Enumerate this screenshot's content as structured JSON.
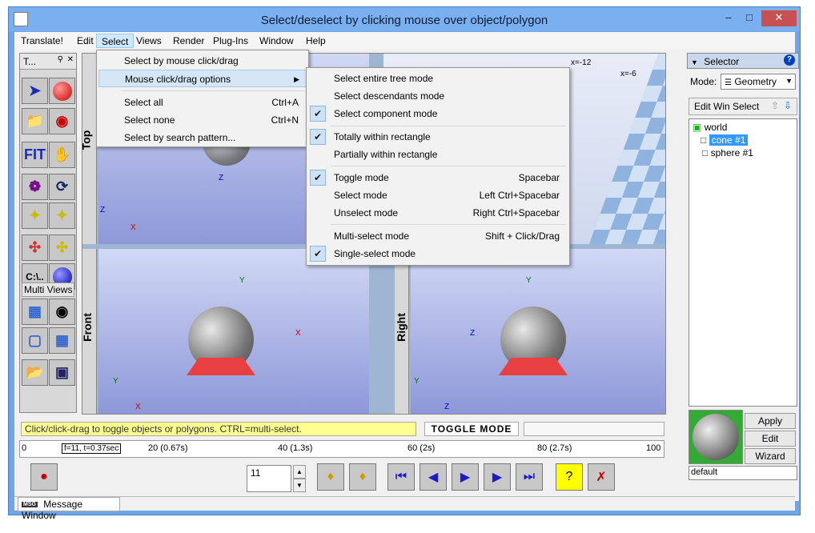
{
  "window": {
    "title": "Select/deselect by clicking mouse over object/polygon"
  },
  "menubar": [
    "Translate!",
    "Edit",
    "Select",
    "Views",
    "Render",
    "Plug-Ins",
    "Window",
    "Help"
  ],
  "select_menu": {
    "items": [
      {
        "label": "Select by mouse click/drag",
        "shortcut": ""
      },
      {
        "label": "Mouse click/drag options",
        "shortcut": ""
      },
      {
        "label": "Select all",
        "shortcut": "Ctrl+A"
      },
      {
        "label": "Select none",
        "shortcut": "Ctrl+N"
      },
      {
        "label": "Select by search pattern...",
        "shortcut": ""
      }
    ]
  },
  "options_submenu": {
    "items": [
      {
        "label": "Select entire tree mode",
        "shortcut": "",
        "checked": false
      },
      {
        "label": "Select descendants mode",
        "shortcut": "",
        "checked": false
      },
      {
        "label": "Select component mode",
        "shortcut": "",
        "checked": true
      },
      {
        "label": "Totally within rectangle",
        "shortcut": "",
        "checked": true
      },
      {
        "label": "Partially within rectangle",
        "shortcut": "",
        "checked": false
      },
      {
        "label": "Toggle mode",
        "shortcut": "Spacebar",
        "checked": true
      },
      {
        "label": "Select mode",
        "shortcut": "Left Ctrl+Spacebar",
        "checked": false
      },
      {
        "label": "Unselect mode",
        "shortcut": "Right Ctrl+Spacebar",
        "checked": false
      },
      {
        "label": "Multi-select mode",
        "shortcut": "Shift + Click/Drag",
        "checked": false
      },
      {
        "label": "Single-select mode",
        "shortcut": "",
        "checked": true
      }
    ]
  },
  "toolbox": {
    "title": "T...",
    "multi_views_label": "Multi Views",
    "fit_label": "FIT",
    "path_label": "C:\\.."
  },
  "viewports": {
    "top": "Top",
    "front": "Front",
    "right": "Right",
    "axis_z": "Z",
    "axis_y": "Y",
    "axis_x": "X",
    "coord_x1": "x=-12",
    "coord_x2": "x=-6"
  },
  "selector": {
    "title": "Selector",
    "mode_label": "Mode:",
    "mode_value": "Geometry",
    "tools": "Edit  Win  Select",
    "tree": [
      "world",
      "cone #1",
      "sphere #1"
    ],
    "buttons": [
      "Apply",
      "Edit",
      "Wizard"
    ],
    "material_name": "default"
  },
  "status": {
    "message": "Click/click-drag to toggle objects or polygons. CTRL=multi-select.",
    "mode": "TOGGLE MODE"
  },
  "timeline": {
    "frame_readout": "f=11, t=0.37sec",
    "ticks": [
      "0",
      "20 (0.67s)",
      "40 (1.3s)",
      "60 (2s)",
      "80 (2.7s)",
      "100"
    ]
  },
  "controls": {
    "frame_value": "11"
  },
  "message_window": {
    "tag": "MSG",
    "label": "Message Window"
  }
}
